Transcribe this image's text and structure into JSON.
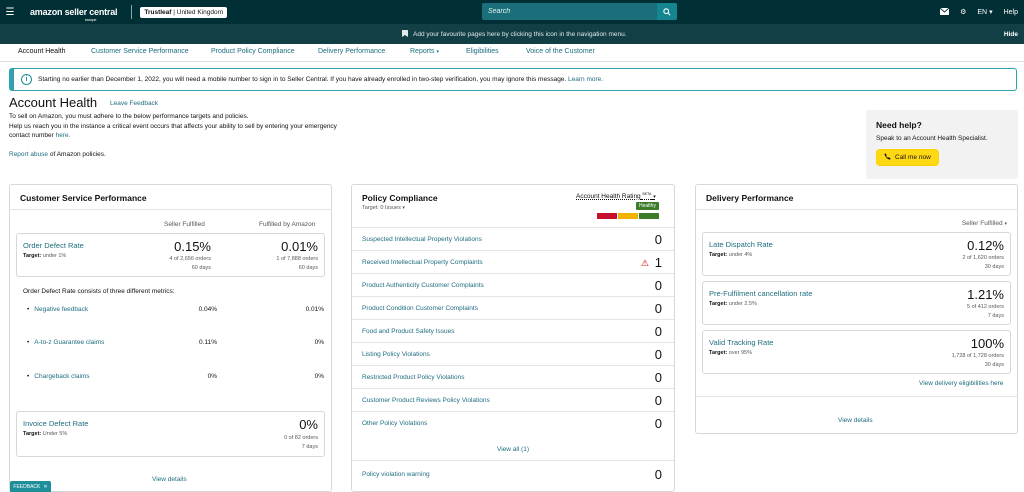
{
  "topbar": {
    "logo": "amazon seller central",
    "logo_sub": "europe",
    "account_store": "Trustleaf",
    "account_region": "United Kingdom",
    "search_placeholder": "Search",
    "language": "EN",
    "help": "Help"
  },
  "favbar": {
    "message": "Add your favourite pages here by clicking this icon in the navigation menu.",
    "hide": "Hide"
  },
  "nav": {
    "tabs": [
      "Account Health",
      "Customer Service Performance",
      "Product Policy Compliance",
      "Delivery Performance",
      "Reports",
      "Eligibilities",
      "Voice of the Customer"
    ]
  },
  "alert": {
    "text": "Starting no earlier than December 1, 2022, you will need a mobile number to sign in to Seller Central. If you have already enrolled in two-step verification, you may ignore this message.",
    "link": "Learn more."
  },
  "header": {
    "title": "Account Health",
    "leave_feedback": "Leave Feedback",
    "intro_1": "To sell on Amazon, you must adhere to the below performance targets and policies.",
    "intro_2": "Help us reach you in the instance a critical event occurs that affects your ability to sell by entering your emergency contact number",
    "intro_link": "here.",
    "abuse_link": "Report abuse",
    "abuse_text": "of Amazon policies."
  },
  "help_box": {
    "title": "Need help?",
    "text": "Speak to an Account Health Specialist.",
    "button": "Call me now"
  },
  "customer_service": {
    "title": "Customer Service Performance",
    "col_seller": "Seller Fulfilled",
    "col_amazon": "Fulfilled by Amazon",
    "odr": {
      "name": "Order Defect Rate",
      "target_label": "Target:",
      "target": "under 1%",
      "seller_value": "0.15%",
      "seller_orders": "4 of 2,656 orders",
      "seller_days": "60 days",
      "amazon_value": "0.01%",
      "amazon_orders": "1 of 7,888 orders",
      "amazon_days": "60 days"
    },
    "odr_desc": "Order Defect Rate consists of three different metrics:",
    "submetrics": [
      {
        "name": "Negative feedback",
        "seller": "0.04%",
        "amazon": "0.01%"
      },
      {
        "name": "A-to-z Guarantee claims",
        "seller": "0.11%",
        "amazon": "0%"
      },
      {
        "name": "Chargeback claims",
        "seller": "0%",
        "amazon": "0%"
      }
    ],
    "idr": {
      "name": "Invoice Defect Rate",
      "target_label": "Target:",
      "target": "Under 5%",
      "value": "0%",
      "orders": "0 of 82 orders",
      "days": "7 days"
    },
    "view_details": "View details"
  },
  "policy": {
    "title": "Policy Compliance",
    "target": "Target: 0 Issues",
    "rating_label": "Account Health Rating",
    "rating_beta": "BETA",
    "rating_status": "Healthy",
    "rows": [
      {
        "name": "Suspected Intellectual Property Violations",
        "value": "0"
      },
      {
        "name": "Received Intellectual Property Complaints",
        "value": "1"
      },
      {
        "name": "Product Authenticity Customer Complaints",
        "value": "0"
      },
      {
        "name": "Product Condition Customer Complaints",
        "value": "0"
      },
      {
        "name": "Food and Product Safety Issues",
        "value": "0"
      },
      {
        "name": "Listing Policy Violations",
        "value": "0"
      },
      {
        "name": "Restricted Product Policy Violations",
        "value": "0"
      },
      {
        "name": "Customer Product Reviews Policy Violations",
        "value": "0"
      },
      {
        "name": "Other Policy Violations",
        "value": "0"
      }
    ],
    "view_all": "View all (1)",
    "warning": {
      "name": "Policy violation warning",
      "value": "0"
    },
    "colors": {
      "red": "#c7102e",
      "yellow": "#f0b400",
      "green": "#3c7d2a"
    }
  },
  "delivery": {
    "title": "Delivery Performance",
    "filter": "Seller Fulfilled",
    "metrics": [
      {
        "name": "Late Dispatch Rate",
        "target_label": "Target:",
        "target": "under 4%",
        "value": "0.12%",
        "orders": "2 of 1,620 orders",
        "days": "30 days"
      },
      {
        "name": "Pre-Fulfilment cancellation rate",
        "target_label": "Target:",
        "target": "under 2.5%",
        "value": "1.21%",
        "orders": "5 of 412 orders",
        "days": "7 days"
      },
      {
        "name": "Valid Tracking Rate",
        "target_label": "Target:",
        "target": "over 95%",
        "value": "100%",
        "orders": "1,728 of 1,728 orders",
        "days": "30 days"
      }
    ],
    "eligibilities_link": "View delivery eligibilities here",
    "view_details": "View details"
  },
  "feedback_tab": "FEEDBACK"
}
